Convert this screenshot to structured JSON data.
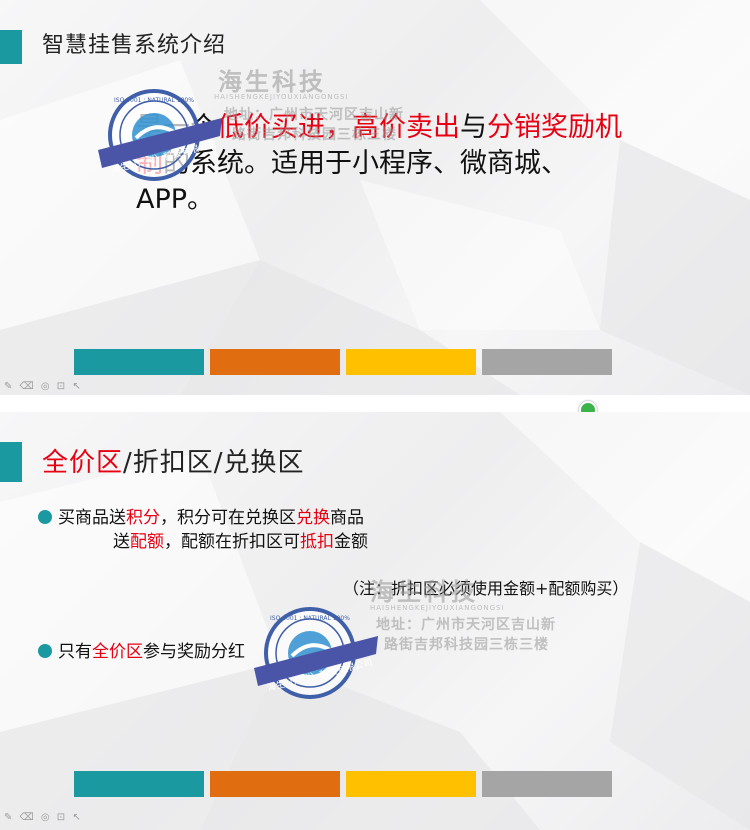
{
  "slide1": {
    "title": "智慧挂售系统介绍",
    "para": {
      "p1": "是一个",
      "p2": "低价买进，高价卖出",
      "p3": "与",
      "p4": "分销奖励机制",
      "p5": "的系统。适用于小程序、微商城、APP。"
    }
  },
  "slide2": {
    "title_red": "全价区",
    "title_rest": "/折扣区/兑换区",
    "bullet1": {
      "a": "买商品送",
      "b": "积分",
      "c": "，积分可在兑换区",
      "d": "兑换",
      "e": "商品"
    },
    "line2": {
      "a": "送",
      "b": "配额",
      "c": "，配额在折扣区可",
      "d": "抵扣",
      "e": "金额"
    },
    "note": "（注：折扣区必须使用金额+配额购买）",
    "bullet2": {
      "a": "只有",
      "b": "全价区",
      "c": "参与奖励分红"
    }
  },
  "watermark": {
    "company": "海生科技",
    "pinyin": "HAISHENGKEJIYOUXIANGONGSI",
    "addr1": "地址：广州市天河区吉山新",
    "addr2": "路街吉邦科技园三栋三楼"
  },
  "seal": {
    "ring_text": "海生（广州）科技有限公司",
    "inner_text": "ISO 9001 : NATURAL 100%"
  },
  "toolbar": {
    "icons": "✎ ⌫ ◎ ⊡ ↖"
  },
  "colors": {
    "teal": "#1a9aa0",
    "orange": "#e06d10",
    "yellow": "#ffc000",
    "gray": "#a5a5a5",
    "red": "#e60012"
  }
}
